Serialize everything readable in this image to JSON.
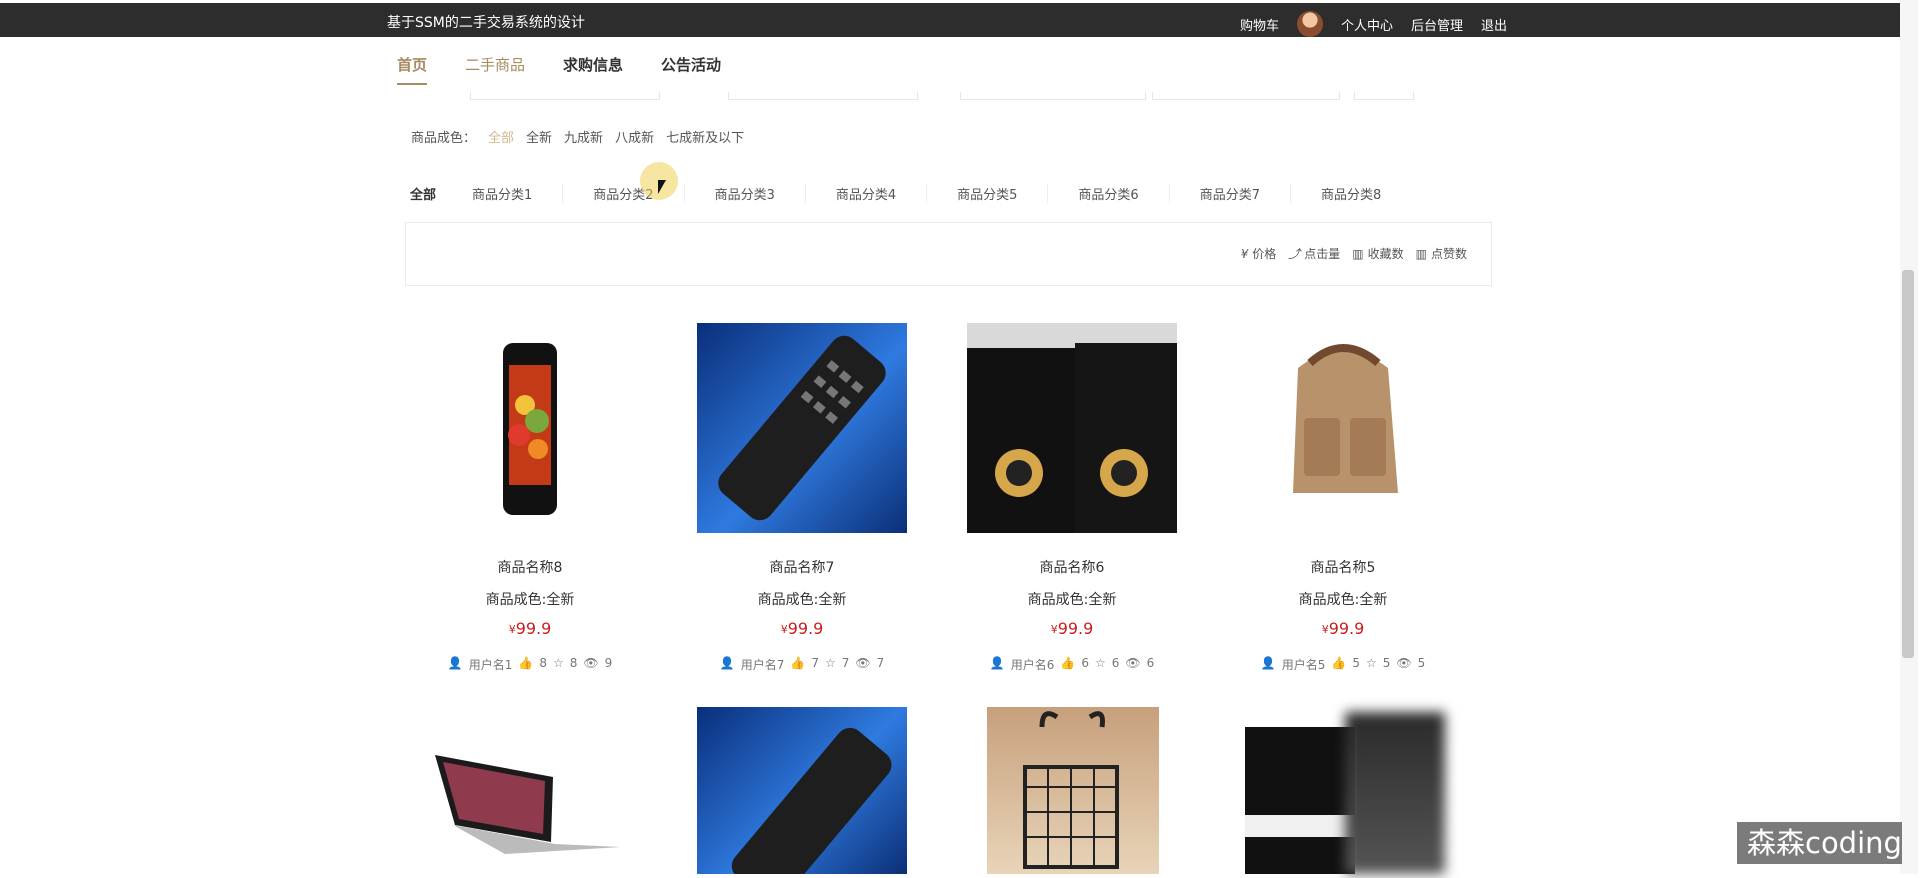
{
  "header": {
    "site_title": "基于SSM的二手交易系统的设计",
    "links": [
      "购物车",
      "个人中心",
      "后台管理",
      "退出"
    ]
  },
  "nav": {
    "items": [
      "首页",
      "二手商品",
      "求购信息",
      "公告活动"
    ],
    "active": "首页"
  },
  "filters": {
    "condition_label": "商品成色：",
    "condition_options": [
      "全部",
      "全新",
      "九成新",
      "八成新",
      "七成新及以下"
    ],
    "categories": [
      "全部",
      "商品分类1",
      "商品分类2",
      "商品分类3",
      "商品分类4",
      "商品分类5",
      "商品分类6",
      "商品分类7",
      "商品分类8"
    ]
  },
  "sorting": {
    "items": [
      "价格",
      "点击量",
      "收藏数",
      "点赞数"
    ],
    "icons": [
      "yen-icon",
      "trend-icon",
      "bar-icon",
      "bar-icon"
    ]
  },
  "products": [
    {
      "name": "商品名称8",
      "condition": "商品成色:全新",
      "currency": "¥",
      "price": "99.9",
      "user": "用户名1",
      "likes": "8",
      "stars": "8",
      "views": "9",
      "image": "phone"
    },
    {
      "name": "商品名称7",
      "condition": "商品成色:全新",
      "currency": "¥",
      "price": "99.9",
      "user": "用户名7",
      "likes": "7",
      "stars": "7",
      "views": "7",
      "image": "remote"
    },
    {
      "name": "商品名称6",
      "condition": "商品成色:全新",
      "currency": "¥",
      "price": "99.9",
      "user": "用户名6",
      "likes": "6",
      "stars": "6",
      "views": "6",
      "image": "speakers"
    },
    {
      "name": "商品名称5",
      "condition": "商品成色:全新",
      "currency": "¥",
      "price": "99.9",
      "user": "用户名5",
      "likes": "5",
      "stars": "5",
      "views": "5",
      "image": "backpack"
    }
  ],
  "next_row_images": [
    "laptop",
    "remote",
    "basket",
    "piano"
  ],
  "watermark": "森森coding"
}
